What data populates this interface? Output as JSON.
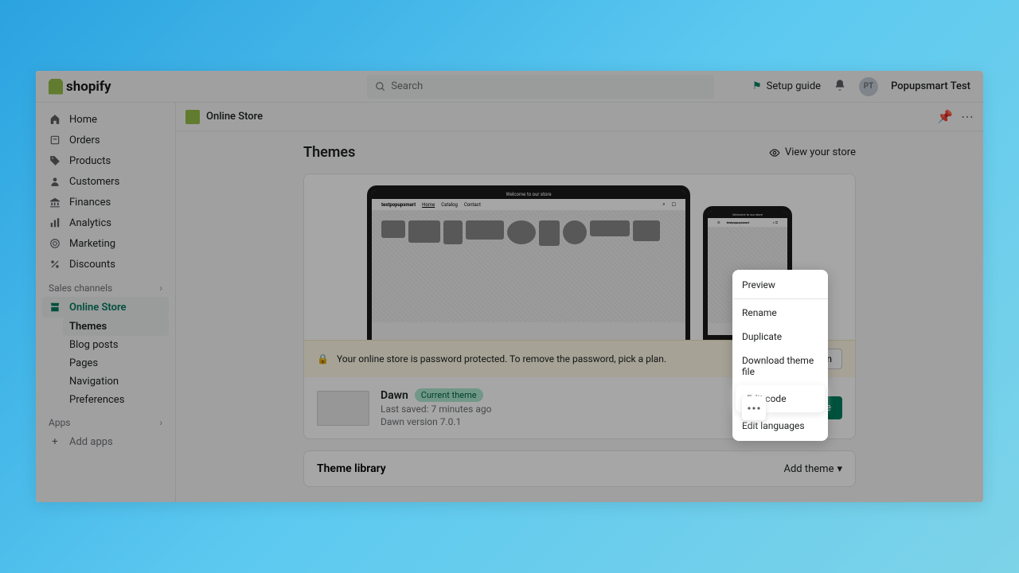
{
  "topbar": {
    "brand": "shopify",
    "search_placeholder": "Search",
    "setup_guide": "Setup guide",
    "store_name": "Popupsmart Test",
    "avatar_initials": "PT"
  },
  "sidebar": {
    "main": [
      {
        "label": "Home"
      },
      {
        "label": "Orders"
      },
      {
        "label": "Products"
      },
      {
        "label": "Customers"
      },
      {
        "label": "Finances"
      },
      {
        "label": "Analytics"
      },
      {
        "label": "Marketing"
      },
      {
        "label": "Discounts"
      }
    ],
    "sales_label": "Sales channels",
    "online_store": "Online Store",
    "sub": [
      {
        "label": "Themes"
      },
      {
        "label": "Blog posts"
      },
      {
        "label": "Pages"
      },
      {
        "label": "Navigation"
      },
      {
        "label": "Preferences"
      }
    ],
    "apps_label": "Apps",
    "add_apps": "Add apps"
  },
  "header": {
    "breadcrumb": "Online Store"
  },
  "page": {
    "title": "Themes",
    "view_store": "View your store"
  },
  "preview": {
    "welcome": "Welcome to our store",
    "sitename": "testpopupsmart",
    "nav1": "Home",
    "nav2": "Catalog",
    "nav3": "Contact"
  },
  "banner": {
    "text": "Your online store is password protected. To remove the password, pick a plan.",
    "btn": "Pick a plan"
  },
  "theme": {
    "name": "Dawn",
    "badge": "Current theme",
    "saved": "Last saved: 7 minutes ago",
    "version": "Dawn version 7.0.1",
    "customize": "Customize"
  },
  "menu": {
    "preview": "Preview",
    "rename": "Rename",
    "duplicate": "Duplicate",
    "download": "Download theme file",
    "edit_code": "Edit code",
    "languages": "Edit languages"
  },
  "library": {
    "title": "Theme library",
    "add": "Add theme"
  }
}
